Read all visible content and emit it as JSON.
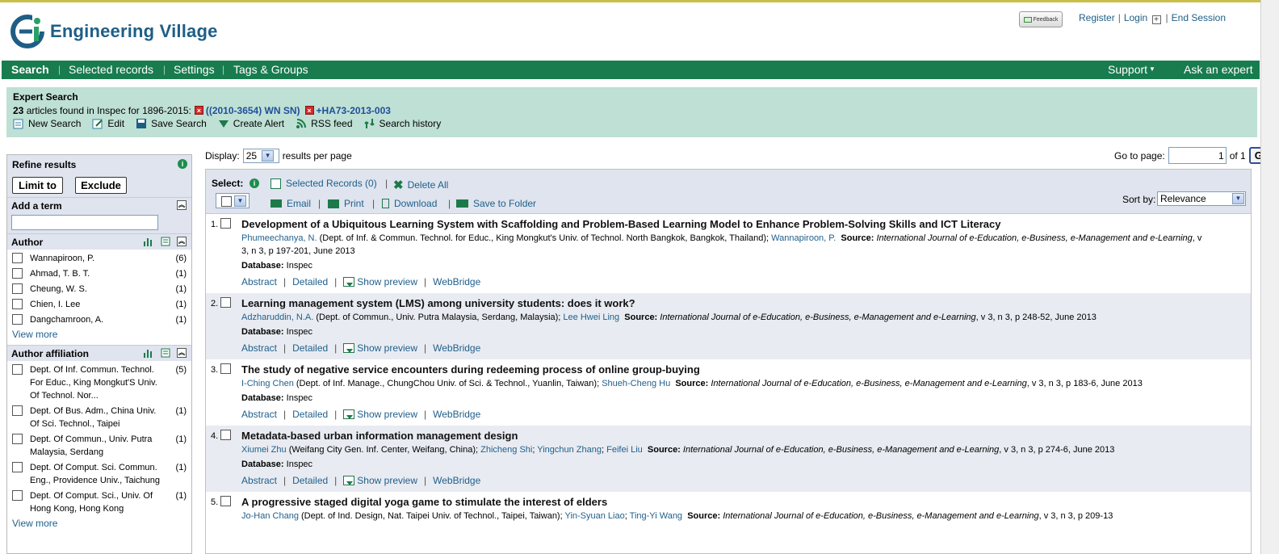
{
  "header": {
    "logo_text": "Engineering Village",
    "feedback_label": "Feedback",
    "register": "Register",
    "login": "Login",
    "end_session": "End Session"
  },
  "nav": {
    "search": "Search",
    "selected_records": "Selected records",
    "settings": "Settings",
    "tags_groups": "Tags & Groups",
    "support": "Support",
    "ask_expert": "Ask an expert"
  },
  "summary": {
    "title": "Expert Search",
    "count": "23",
    "count_text": "articles found in Inspec for 1896-2015:",
    "query1": "((2010-3654) WN SN)",
    "query2": "+HA73-2013-003",
    "tools": {
      "new_search": "New Search",
      "edit": "Edit",
      "save_search": "Save Search",
      "create_alert": "Create Alert",
      "rss": "RSS feed",
      "history": "Search history"
    }
  },
  "refine": {
    "title": "Refine results",
    "limit_to": "Limit to",
    "exclude": "Exclude",
    "add_term": "Add a term",
    "author_title": "Author",
    "authors": [
      {
        "name": "Wannapiroon, P.",
        "count": "(6)"
      },
      {
        "name": "Ahmad, T. B. T.",
        "count": "(1)"
      },
      {
        "name": "Cheung, W. S.",
        "count": "(1)"
      },
      {
        "name": "Chien, I. Lee",
        "count": "(1)"
      },
      {
        "name": "Dangchamroon, A.",
        "count": "(1)"
      }
    ],
    "view_more": "View more",
    "affil_title": "Author affiliation",
    "affiliations": [
      {
        "name": "Dept. Of Inf. Commun. Technol. For Educ., King Mongkut'S Univ. Of Technol. Nor...",
        "count": "(5)"
      },
      {
        "name": "Dept. Of Bus. Adm., China Univ. Of Sci. Technol., Taipei",
        "count": "(1)"
      },
      {
        "name": "Dept. Of Commun., Univ. Putra Malaysia, Serdang",
        "count": "(1)"
      },
      {
        "name": "Dept. Of Comput. Sci. Commun. Eng., Providence Univ., Taichung",
        "count": "(1)"
      },
      {
        "name": "Dept. Of Comput. Sci., Univ. Of Hong Kong, Hong Kong",
        "count": "(1)"
      }
    ],
    "view_more2": "View more"
  },
  "display": {
    "label": "Display:",
    "per_page": "25",
    "suffix": "results per page",
    "goto_label": "Go to page:",
    "page_value": "1",
    "of_text": "of 1",
    "go": "Go"
  },
  "toolbar": {
    "select": "Select:",
    "selected_records": "Selected Records (0)",
    "delete_all": "Delete All",
    "email": "Email",
    "print": "Print",
    "download": "Download",
    "save_folder": "Save to Folder",
    "sort_by": "Sort by:",
    "sort_value": "Relevance"
  },
  "labels": {
    "source": "Source:",
    "database": "Database:",
    "abstract": "Abstract",
    "detailed": "Detailed",
    "show_preview": "Show preview",
    "webbridge": "WebBridge"
  },
  "records": [
    {
      "num": "1.",
      "title": "Development of a Ubiquitous Learning System with Scaffolding and Problem-Based Learning Model to Enhance Problem-Solving Skills and ICT Literacy",
      "author1": "Phumeechanya, N.",
      "affil1": " (Dept. of Inf. & Commun. Technol. for Educ., King Mongkut's Univ. of Technol. North Bangkok, Bangkok, Thailand);",
      "author2": "Wannapiroon, P.",
      "source": "International Journal of e-Education, e-Business, e-Management and e-Learning",
      "details": ", v 3, n 3, p 197-201, June 2013",
      "database": "Inspec"
    },
    {
      "num": "2.",
      "title": "Learning management system (LMS) among university students: does it work?",
      "author1": "Adzharuddin, N.A.",
      "affil1": " (Dept. of Commun., Univ. Putra Malaysia, Serdang, Malaysia);",
      "author2": "Lee Hwei Ling",
      "source": "International Journal of e-Education, e-Business, e-Management and e-Learning",
      "details": ", v 3, n 3, p 248-52, June 2013",
      "database": "Inspec"
    },
    {
      "num": "3.",
      "title": "The study of negative service encounters during redeeming process of online group-buying",
      "author1": "I-Ching Chen",
      "affil1": " (Dept. of Inf. Manage., ChungChou Univ. of Sci. & Technol., Yuanlin, Taiwan);",
      "author2": "Shueh-Cheng Hu",
      "source": "International Journal of e-Education, e-Business, e-Management and e-Learning",
      "details": ", v 3, n 3, p 183-6, June 2013",
      "database": "Inspec"
    },
    {
      "num": "4.",
      "title": "Metadata-based urban information management design",
      "author1": "Xiumei Zhu",
      "affil1": " (Weifang City Gen. Inf. Center, Weifang, China);",
      "author2": "Zhicheng Shi",
      "author3": "Yingchun Zhang",
      "author4": "Feifei Liu",
      "source": "International Journal of e-Education, e-Business, e-Management and e-Learning",
      "details": ", v 3, n 3, p 274-6, June 2013",
      "database": "Inspec"
    },
    {
      "num": "5.",
      "title": "A progressive staged digital yoga game to stimulate the interest of elders",
      "author1": "Jo-Han Chang",
      "affil1": " (Dept. of Ind. Design, Nat. Taipei Univ. of Technol., Taipei, Taiwan);",
      "author2": "Yin-Syuan Liao",
      "author3": "Ting-Yi Wang",
      "source": "International Journal of e-Education, e-Business, e-Management and e-Learning",
      "details": ", v 3, n 3, p 209-13"
    }
  ]
}
